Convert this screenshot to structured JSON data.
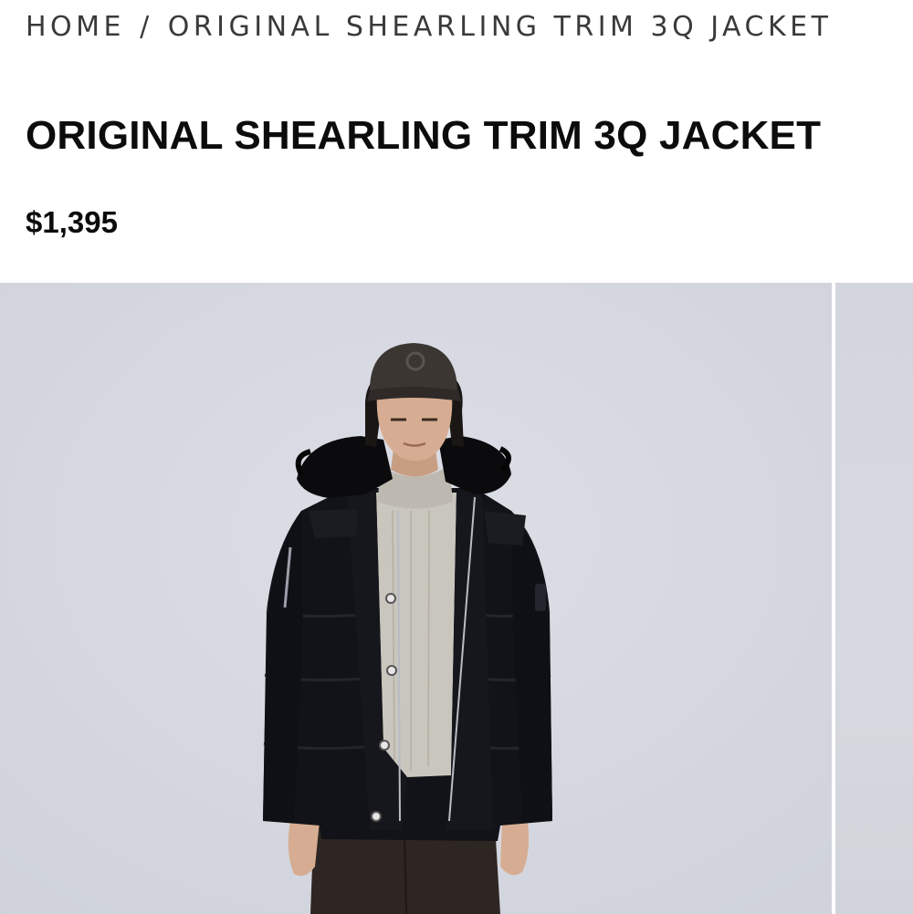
{
  "breadcrumb": {
    "home": "HOME",
    "separator": "/",
    "current": "ORIGINAL SHEARLING TRIM 3Q JACKET"
  },
  "product": {
    "title": "ORIGINAL SHEARLING TRIM 3Q JACKET",
    "price": "$1,395"
  },
  "gallery": {
    "main_image": "model-wearing-black-shearling-trim-3q-jacket",
    "next_image": "next-product-image-peek"
  },
  "colors": {
    "backdrop": "#d4d7e0",
    "jacket": "#121318",
    "fur": "#0b0b0d",
    "sweater": "#c9c6bd",
    "cap": "#3c3633",
    "pants": "#2e2622",
    "skin": "#d6ad92"
  }
}
